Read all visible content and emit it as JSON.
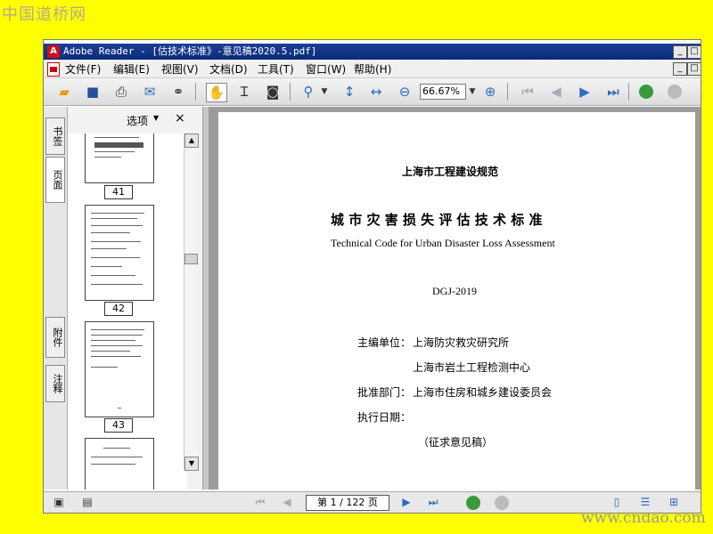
{
  "watermark": {
    "top": "中国道桥网",
    "bottom": "www.cndao.com"
  },
  "window": {
    "app_icon_letter": "A",
    "title": "Adobe Reader - [估技术标准》-意见稿2020.5.pdf]",
    "minimize": "_",
    "maximize": "□"
  },
  "menu": [
    "文件(F)",
    "编辑(E)",
    "视图(V)",
    "文档(D)",
    "工具(T)",
    "窗口(W)",
    "帮助(H)"
  ],
  "toolbar": {
    "zoom_value": "66.67%"
  },
  "side_tabs": {
    "bookmarks": "书签",
    "pages": "页面",
    "attachments": "附件",
    "comments": "注释"
  },
  "nav_panel": {
    "options_label": "选项",
    "close_label": "×",
    "thumbnails": [
      {
        "page": "41"
      },
      {
        "page": "42"
      },
      {
        "page": "43"
      }
    ]
  },
  "document": {
    "header": "上海市工程建设规范",
    "title_cn": "城 市 灾 害 损 失 评 估 技 术 标 准",
    "title_en": "Technical Code for Urban Disaster Loss Assessment",
    "code": "DGJ-2019",
    "editor_label": "主编单位：",
    "editor_1": "上海防灾救灾研究所",
    "editor_2": "上海市岩土工程检测中心",
    "approval_label": "批准部门：",
    "approval_value": "上海市住房和城乡建设委员会",
    "effective_label": "执行日期：",
    "draft_note": "（征求意见稿）"
  },
  "status": {
    "page_indicator": "第 1 / 122 页"
  }
}
